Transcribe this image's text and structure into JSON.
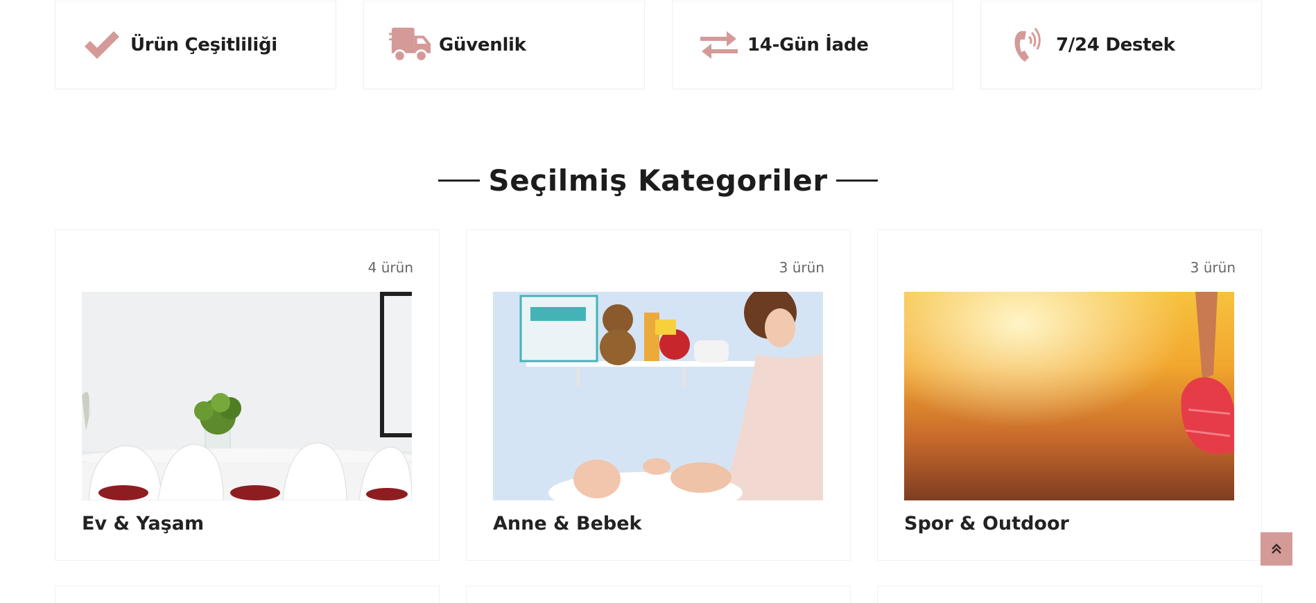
{
  "features": [
    {
      "icon": "check-icon",
      "label": "Ürün Çeşitliliği"
    },
    {
      "icon": "truck-icon",
      "label": "Güvenlik"
    },
    {
      "icon": "exchange-arrows-icon",
      "label": "14-Gün İade"
    },
    {
      "icon": "phone-icon",
      "label": "7/24 Destek"
    }
  ],
  "section": {
    "title": "Seçilmiş Kategoriler"
  },
  "categories": [
    {
      "name": "Ev & Yaşam",
      "count": "4 ürün",
      "image": "dining-room-image"
    },
    {
      "name": "Anne & Bebek",
      "count": "3 ürün",
      "image": "mother-baby-image"
    },
    {
      "name": "Spor & Outdoor",
      "count": "3 ürün",
      "image": "runner-track-image"
    }
  ],
  "colors": {
    "accent": "#d49a98",
    "border": "#eceef5",
    "text": "#1e1e1e",
    "muted": "#666666"
  }
}
